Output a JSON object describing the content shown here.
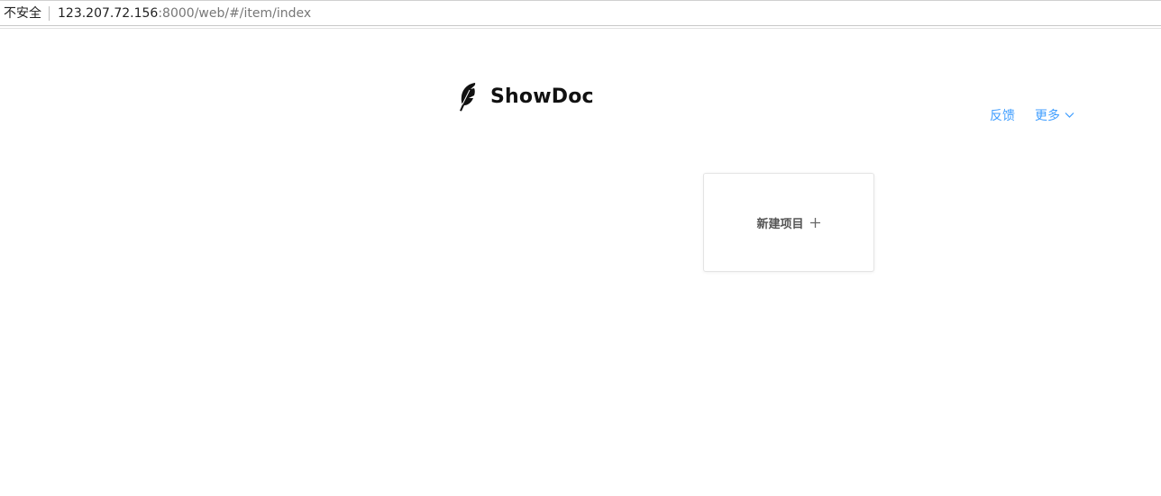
{
  "browser": {
    "security_label": "不安全",
    "url_host": "123.207.72.156",
    "url_path": ":8000/web/#/item/index"
  },
  "header": {
    "logo_text": "ShowDoc",
    "logo_icon": "feather-icon"
  },
  "nav": {
    "feedback_label": "反馈",
    "more_label": "更多",
    "more_icon": "chevron-down-icon",
    "link_color": "#409eff"
  },
  "main": {
    "new_project_label": "新建项目",
    "new_project_icon": "plus-icon"
  }
}
